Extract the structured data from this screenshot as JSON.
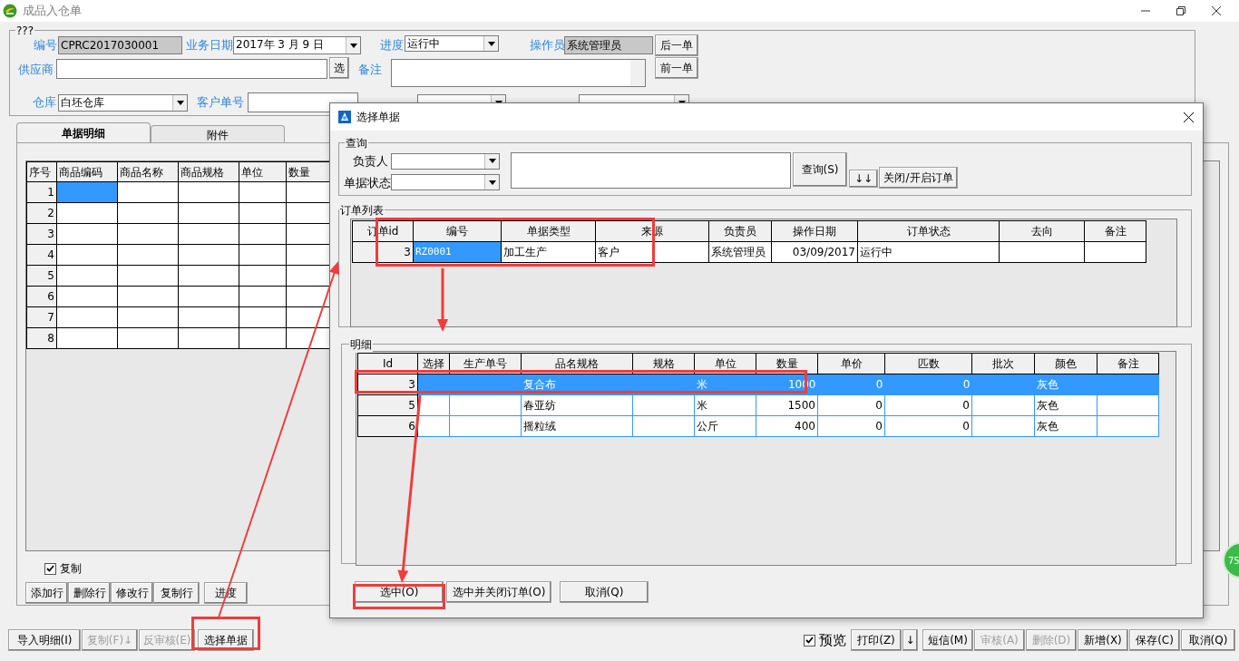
{
  "window": {
    "title": "成品入仓单"
  },
  "header": {
    "legend": "???",
    "number": {
      "label": "编号",
      "value": "CPRC2017030001"
    },
    "date": {
      "label": "业务日期",
      "value": "2017年 3 月 9 日"
    },
    "progress": {
      "label": "进度",
      "value": "运行中"
    },
    "operator": {
      "label": "操作员",
      "value": "系统管理员"
    },
    "next_button": "后一单",
    "supplier": {
      "label": "供应商"
    },
    "supplier_button": "选",
    "remark": {
      "label": "备注"
    },
    "prev_button": "前一单",
    "warehouse": {
      "label": "仓库",
      "value": "白坯仓库"
    },
    "customer_no": {
      "label": "客户单号"
    }
  },
  "tabs": [
    {
      "label": "单据明细",
      "selected": true
    },
    {
      "label": "附件",
      "selected": false
    }
  ],
  "detail_table": {
    "columns": [
      "序号",
      "商品编码",
      "商品名称",
      "商品规格",
      "单位",
      "数量"
    ],
    "rows": [
      {
        "no": "1",
        "selected": true
      },
      {
        "no": "2",
        "selected": false
      },
      {
        "no": "3",
        "selected": false
      },
      {
        "no": "4",
        "selected": false
      },
      {
        "no": "5",
        "selected": false
      },
      {
        "no": "6",
        "selected": false
      },
      {
        "no": "7",
        "selected": false
      },
      {
        "no": "8",
        "selected": false
      }
    ]
  },
  "copy_checkbox": {
    "label": "复制",
    "checked": true
  },
  "row_buttons": [
    "添加行",
    "删除行",
    "修改行",
    "复制行",
    "进度"
  ],
  "bottom_left": [
    {
      "label": "导入明细(I)",
      "disabled": false
    },
    {
      "label": "复制(F)↓",
      "disabled": true
    },
    {
      "label": "反审核(E)",
      "disabled": true
    },
    {
      "label": "选择单据",
      "disabled": false
    }
  ],
  "preview_checkbox": {
    "label": "预览",
    "checked": true
  },
  "bottom_right": [
    {
      "label": "打印(Z)",
      "disabled": false
    },
    {
      "label": "↓",
      "disabled": false
    },
    {
      "label": "短信(M)",
      "disabled": false
    },
    {
      "label": "审核(A)",
      "disabled": true
    },
    {
      "label": "删除(D)",
      "disabled": true
    },
    {
      "label": "新增(X)",
      "disabled": false
    },
    {
      "label": "保存(C)",
      "disabled": false
    },
    {
      "label": "取消(Q)",
      "disabled": false
    }
  ],
  "badge": "75",
  "dialog": {
    "title": "选择单据",
    "query": {
      "legend": "查询",
      "manager_label": "负责人",
      "status_label": "单据状态",
      "search_button": "查询(S)",
      "sort_button": "↓↓",
      "toggle_button": "关闭/开启订单"
    },
    "orders": {
      "legend": "订单列表",
      "columns": [
        "订单id",
        "编号",
        "单据类型",
        "来源",
        "负责员",
        "操作日期",
        "订单状态",
        "去向",
        "备注"
      ],
      "rows": [
        {
          "cells": [
            "3",
            "RZ0001",
            "加工生产",
            "客户",
            "系统管理员",
            "03/09/2017",
            "运行中",
            null,
            null
          ],
          "selected": true
        }
      ]
    },
    "details": {
      "legend": "明细",
      "columns": [
        "Id",
        "选择",
        "生产单号",
        "品名规格",
        "规格",
        "单位",
        "数量",
        "单价",
        "匹数",
        "批次",
        "颜色",
        "备注"
      ],
      "rows": [
        {
          "cells": [
            "3",
            null,
            null,
            "复合布",
            null,
            "米",
            "1000",
            "0",
            "0",
            null,
            "灰色",
            null
          ],
          "selected": true
        },
        {
          "cells": [
            "5",
            null,
            null,
            "春亚纺",
            null,
            "米",
            "1500",
            "0",
            "0",
            null,
            "灰色",
            null
          ],
          "selected": false
        },
        {
          "cells": [
            "6",
            null,
            null,
            "摇粒绒",
            null,
            "公斤",
            "400",
            "0",
            "0",
            null,
            "灰色",
            null
          ],
          "selected": false
        }
      ]
    },
    "buttons": [
      "选中(O)",
      "选中并关闭订单(O)",
      "取消(Q)"
    ]
  }
}
